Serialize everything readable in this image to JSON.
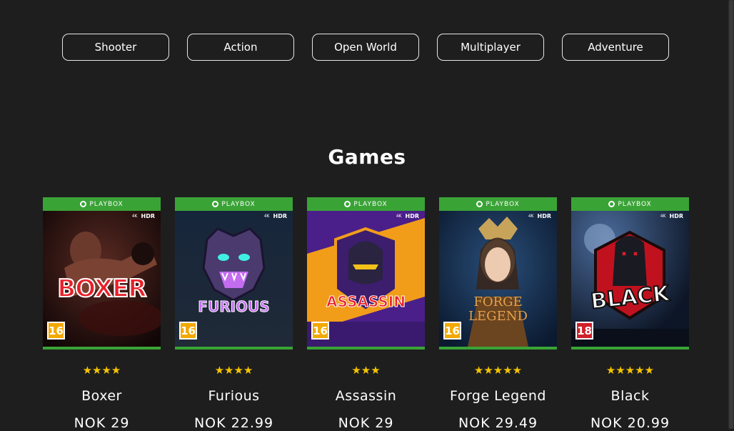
{
  "categories": [
    "Shooter",
    "Action",
    "Open World",
    "Multiplayer",
    "Adventure"
  ],
  "section_title": "Games",
  "games": [
    {
      "title": "Boxer",
      "cover_title": "BOXER",
      "platform": "PLAYBOX",
      "age": "16",
      "stars": 4,
      "star_glyphs": "★★★★",
      "price": "NOK 29",
      "colors": {
        "age_bg": "#f2a900"
      }
    },
    {
      "title": "Furious",
      "cover_title": "FURIOUS",
      "platform": "PLAYBOX",
      "age": "16",
      "stars": 4,
      "star_glyphs": "★★★★",
      "price": "NOK 22.99",
      "colors": {
        "age_bg": "#f2a900"
      }
    },
    {
      "title": "Assassin",
      "cover_title": "ASSASSIN",
      "platform": "PLAYBOX",
      "age": "16",
      "stars": 3,
      "star_glyphs": "★★★",
      "price": "NOK 29",
      "colors": {
        "age_bg": "#f2a900"
      }
    },
    {
      "title": "Forge Legend",
      "cover_title": "FORGE LEGEND",
      "platform": "PLAYBOX",
      "age": "16",
      "stars": 5,
      "star_glyphs": "★★★★★",
      "price": "NOK 29.49",
      "colors": {
        "age_bg": "#f2a900"
      }
    },
    {
      "title": "Black",
      "cover_title": "BLACK",
      "platform": "PLAYBOX",
      "age": "18",
      "stars": 5,
      "star_glyphs": "★★★★★",
      "price": "NOK 20.99",
      "colors": {
        "age_bg": "#d0202a"
      }
    }
  ],
  "cover_badges": {
    "resolution": "4K",
    "hdr": "HDR"
  },
  "colors": {
    "background": "#1e1e1f",
    "accent_green": "#3aa336",
    "star": "#f5c400"
  }
}
